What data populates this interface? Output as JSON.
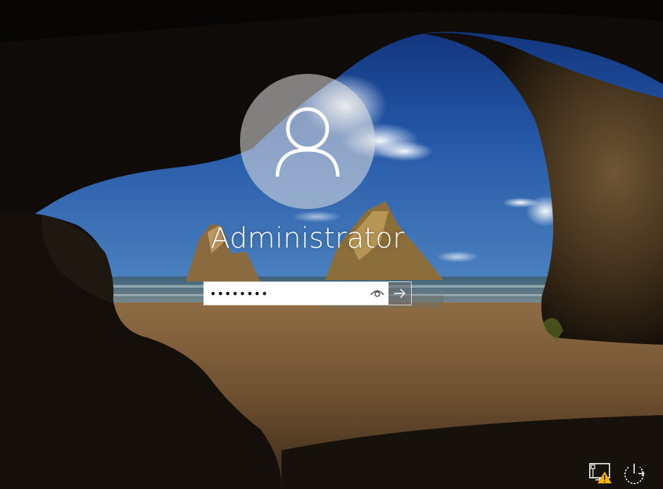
{
  "login": {
    "username": "Administrator",
    "password_masked": "••••••••"
  },
  "icons": {
    "avatar": "user-silhouette-icon",
    "reveal": "eye-icon",
    "submit": "arrow-right-icon",
    "network": "network-warning-icon",
    "power": "power-icon"
  },
  "colors": {
    "warning": "#f5b400",
    "field_bg": "#ffffff",
    "text": "#ffffff"
  }
}
